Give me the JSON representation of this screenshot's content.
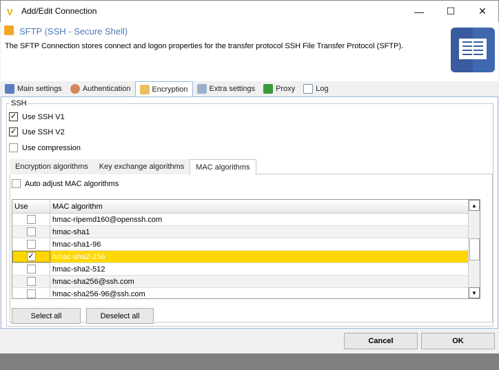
{
  "window": {
    "title": "Add/Edit Connection",
    "controls": [
      "minimize",
      "maximize",
      "close"
    ]
  },
  "header": {
    "title": "SFTP (SSH - Secure Shell)",
    "description": "The SFTP Connection stores connect and logon properties for the transfer protocol SSH File Transfer Protocol (SFTP)."
  },
  "tabs": [
    {
      "label": "Main settings",
      "icon": "gear-icon"
    },
    {
      "label": "Authentication",
      "icon": "user-icon"
    },
    {
      "label": "Encryption",
      "icon": "lock-icon",
      "active": true
    },
    {
      "label": "Extra settings",
      "icon": "table-icon"
    },
    {
      "label": "Proxy",
      "icon": "proxy-icon"
    },
    {
      "label": "Log",
      "icon": "log-icon"
    }
  ],
  "ssh": {
    "group_label": "SSH",
    "options": [
      {
        "label": "Use SSH V1",
        "checked": true
      },
      {
        "label": "Use SSH V2",
        "checked": true
      },
      {
        "label": "Use compression",
        "checked": false
      }
    ]
  },
  "inner_tabs": [
    {
      "label": "Encryption algorithms"
    },
    {
      "label": "Key exchange algorithms"
    },
    {
      "label": "MAC algorithms",
      "active": true
    }
  ],
  "mac": {
    "auto_adjust_label": "Auto adjust MAC algorithms",
    "auto_adjust": false,
    "columns": [
      "Use",
      "MAC algorithm"
    ],
    "rows": [
      {
        "name": "hmac-ripemd160@openssh.com",
        "use": false
      },
      {
        "name": "hmac-sha1",
        "use": false
      },
      {
        "name": "hmac-sha1-96",
        "use": false
      },
      {
        "name": "hmac-sha2-256",
        "use": true,
        "selected": true
      },
      {
        "name": "hmac-sha2-512",
        "use": false
      },
      {
        "name": "hmac-sha256@ssh.com",
        "use": false
      },
      {
        "name": "hmac-sha256-96@ssh.com",
        "use": false
      }
    ],
    "select_all": "Select all",
    "deselect_all": "Deselect all"
  },
  "footer": {
    "cancel": "Cancel",
    "ok": "OK"
  },
  "colors": {
    "selection": "#ffd700",
    "header_title": "#4a7ab8"
  }
}
